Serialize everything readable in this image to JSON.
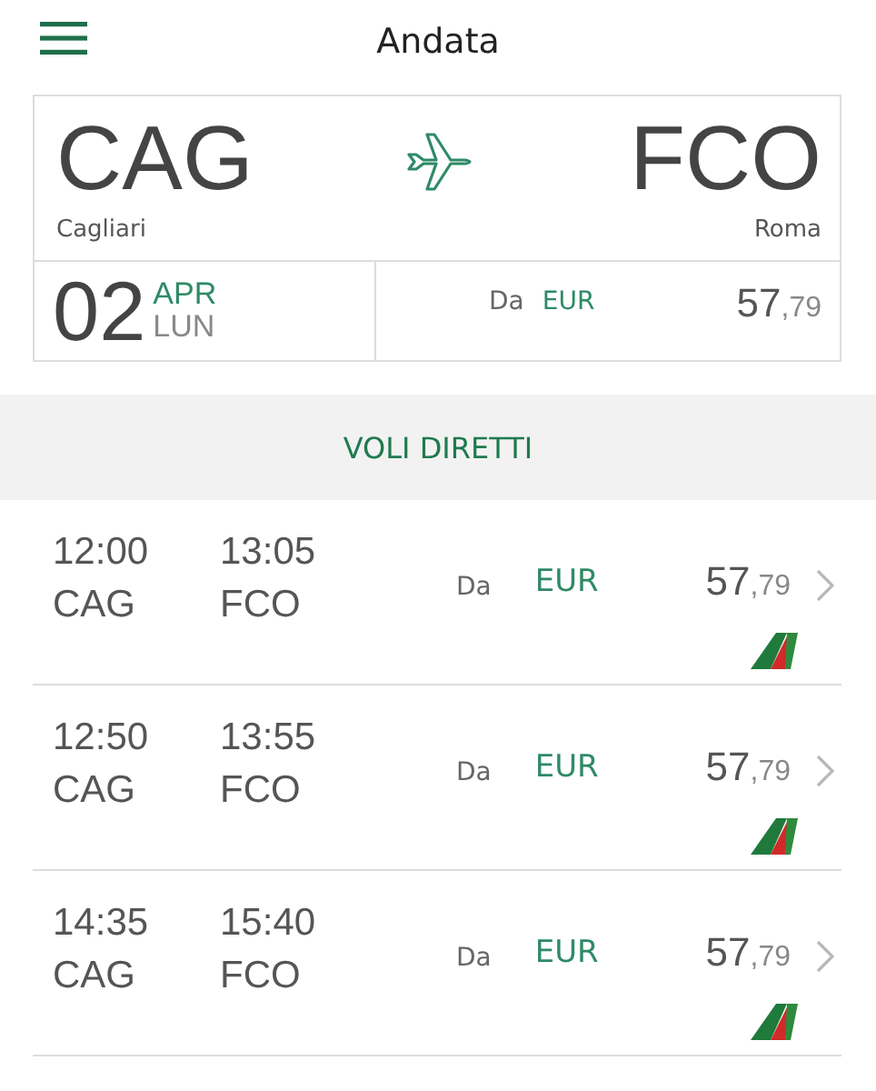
{
  "header": {
    "title": "Andata"
  },
  "summary": {
    "from_code": "CAG",
    "from_city": "Cagliari",
    "to_code": "FCO",
    "to_city": "Roma",
    "day": "02",
    "month": "APR",
    "weekday": "LUN",
    "from_label": "Da",
    "currency": "EUR",
    "price": "57",
    "cents": ",79"
  },
  "section": {
    "title": "VOLI DIRETTI"
  },
  "flights": [
    {
      "depart_time": "12:00",
      "depart_code": "CAG",
      "arrive_time": "13:05",
      "arrive_code": "FCO",
      "from_label": "Da",
      "currency": "EUR",
      "price": "57",
      "cents": ",79"
    },
    {
      "depart_time": "12:50",
      "depart_code": "CAG",
      "arrive_time": "13:55",
      "arrive_code": "FCO",
      "from_label": "Da",
      "currency": "EUR",
      "price": "57",
      "cents": ",79"
    },
    {
      "depart_time": "14:35",
      "depart_code": "CAG",
      "arrive_time": "15:40",
      "arrive_code": "FCO",
      "from_label": "Da",
      "currency": "EUR",
      "price": "57",
      "cents": ",79"
    }
  ]
}
